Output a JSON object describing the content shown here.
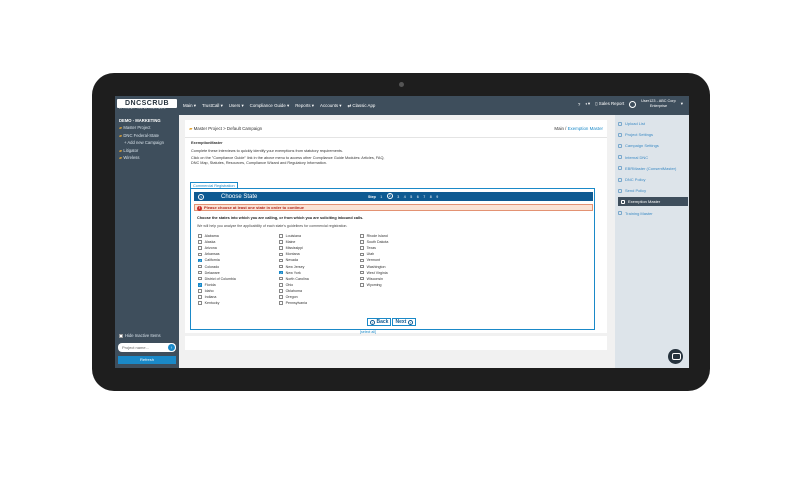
{
  "brand": {
    "logo_text": "DNCSCRUB",
    "tagline": "BY CONTACT CENTER COMPLIANCE"
  },
  "topnav": [
    "Main ▾",
    "TrustCall ▾",
    "Users ▾",
    "Compliance Guide ▾",
    "Reports ▾",
    "Accounts ▾",
    "⇄ Classic App"
  ],
  "topright": {
    "sales_report": "Sales Report",
    "user_line1": "User123 - ABC Corp",
    "user_line2": "Enterprise"
  },
  "sidebar": {
    "header": "DEMO - MARKETING",
    "items": [
      "Master Project",
      "DNC Federal-State",
      "+ Add new Campaign",
      "Litigator",
      "Wireless"
    ],
    "hide_inactive": "Hide Inactive Items",
    "project_placeholder": "Project name...",
    "refresh": "Refresh"
  },
  "breadcrumb": {
    "path": "Master Project > Default Campaign",
    "main": "Main",
    "sep": " / ",
    "current": "Exemption Master"
  },
  "intro": {
    "title": "ExemptionMaster",
    "p1": "Complete these interviews to quickly identify your exemptions from statutory requirements.",
    "p2": "Click on the \"Compliance Guide\" link in the above menu to access other Compliance Guide Modules: Articles, FAQ, DNC Map, Statutes, Resources, Compliance Wizard and Regulatory Information."
  },
  "tab": "Commercial Registration",
  "step": {
    "title": "Choose State",
    "label": "Step",
    "numbers": [
      "1",
      "2",
      "3",
      "4",
      "5",
      "6",
      "7",
      "8",
      "9"
    ],
    "current": "2"
  },
  "alert": "Please choose at least one state in order to continue",
  "instructions": {
    "line1": "Choose the states into which you are calling, or from which you are soliciting inbound calls.",
    "line2": "We will help you analyze the applicability of each state's guidelines for commercial registration."
  },
  "states": {
    "col1": [
      {
        "name": "Alabama",
        "checked": false
      },
      {
        "name": "Alaska",
        "checked": false
      },
      {
        "name": "Arizona",
        "checked": false
      },
      {
        "name": "Arkansas",
        "checked": false
      },
      {
        "name": "California",
        "checked": true
      },
      {
        "name": "Colorado",
        "checked": false
      },
      {
        "name": "Delaware",
        "checked": false
      },
      {
        "name": "District of Columbia",
        "checked": false
      },
      {
        "name": "Florida",
        "checked": true
      },
      {
        "name": "Idaho",
        "checked": false
      },
      {
        "name": "Indiana",
        "checked": false
      },
      {
        "name": "Kentucky",
        "checked": false
      }
    ],
    "col2": [
      {
        "name": "Louisiana",
        "checked": false
      },
      {
        "name": "Maine",
        "checked": false
      },
      {
        "name": "Mississippi",
        "checked": false
      },
      {
        "name": "Montana",
        "checked": false
      },
      {
        "name": "Nevada",
        "checked": false
      },
      {
        "name": "New Jersey",
        "checked": false
      },
      {
        "name": "New York",
        "checked": true
      },
      {
        "name": "North Carolina",
        "checked": false
      },
      {
        "name": "Ohio",
        "checked": false
      },
      {
        "name": "Oklahoma",
        "checked": false
      },
      {
        "name": "Oregon",
        "checked": false
      },
      {
        "name": "Pennsylvania",
        "checked": false
      }
    ],
    "col3": [
      {
        "name": "Rhode Island",
        "checked": false
      },
      {
        "name": "South Dakota",
        "checked": false
      },
      {
        "name": "Texas",
        "checked": false
      },
      {
        "name": "Utah",
        "checked": false
      },
      {
        "name": "Vermont",
        "checked": false
      },
      {
        "name": "Washington",
        "checked": false
      },
      {
        "name": "West Virginia",
        "checked": false
      },
      {
        "name": "Wisconsin",
        "checked": false
      },
      {
        "name": "Wyoming",
        "checked": false
      }
    ],
    "select_all": "[select all]",
    "select_none": "[select none]"
  },
  "buttons": {
    "back": "Back",
    "next": "Next"
  },
  "rightbar": [
    "Upload List",
    "Project Settings",
    "Campaign Settings",
    "Internal DNC",
    "EBRMaster (ConsentMaster)",
    "DNC Policy",
    "Send Policy",
    "Exemption Master",
    "Training Master"
  ],
  "rightbar_active": "Exemption Master"
}
